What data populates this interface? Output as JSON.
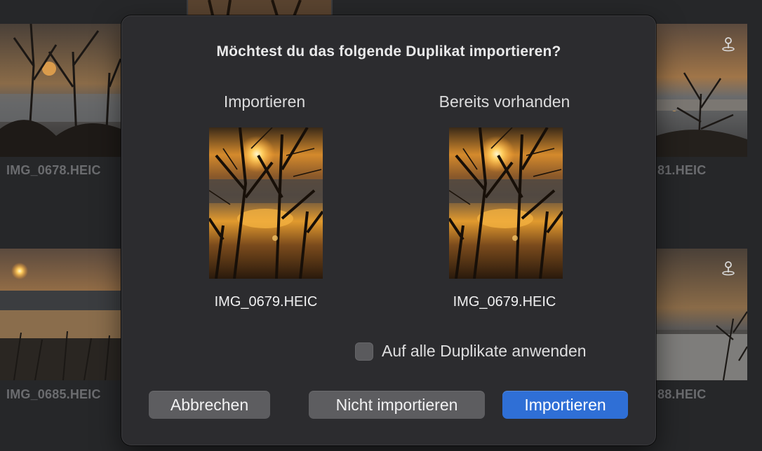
{
  "background_grid": {
    "tiles": [
      {
        "filename": "IMG_0678.HEIC",
        "has_location": false
      },
      {
        "filename": "81.HEIC",
        "has_location": true
      },
      {
        "filename": "IMG_0685.HEIC",
        "has_location": false
      },
      {
        "filename": "88.HEIC",
        "has_location": true
      }
    ],
    "location_icon": "map-pin-icon"
  },
  "dialog": {
    "title": "Möchtest du das folgende Duplikat importieren?",
    "import_column": {
      "heading": "Importieren",
      "filename": "IMG_0679.HEIC"
    },
    "existing_column": {
      "heading": "Bereits vorhanden",
      "filename": "IMG_0679.HEIC"
    },
    "apply_all": {
      "label": "Auf alle Duplikate anwenden",
      "checked": false
    },
    "buttons": {
      "cancel": "Abbrechen",
      "dont_import": "Nicht importieren",
      "import": "Importieren"
    }
  },
  "colors": {
    "dialog_bg": "#2c2c2f",
    "button_bg": "#5d5d60",
    "primary_button_bg": "#2f6fd6",
    "window_bg": "#262729"
  }
}
